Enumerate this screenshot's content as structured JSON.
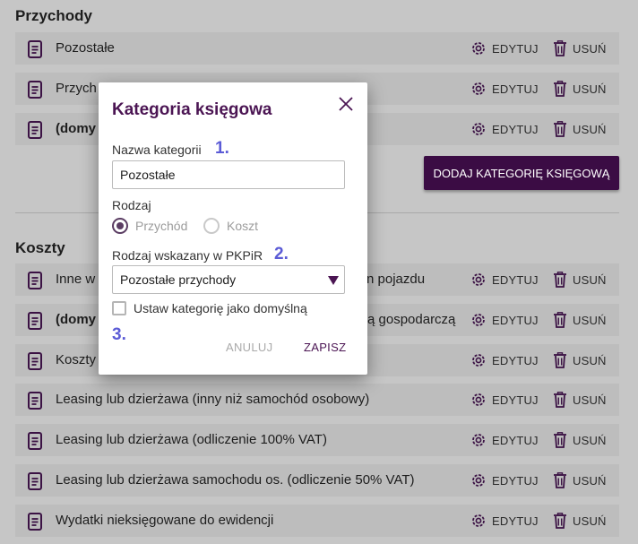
{
  "income": {
    "title": "Przychody",
    "rows": [
      {
        "label": "Pozostałe",
        "bold": false
      },
      {
        "label": "Przych",
        "bold": false
      },
      {
        "label": "(domy",
        "bold": true
      }
    ],
    "add_button_label": "DODAJ KATEGORIĘ KSIĘGOWĄ"
  },
  "costs": {
    "title": "Koszty",
    "rows": [
      {
        "label": "Inne w",
        "tail": "n pojazdu",
        "bold": false
      },
      {
        "label": "(domy",
        "tail": "ą gospodarczą",
        "bold": true
      },
      {
        "label": "Koszty",
        "tail": "",
        "bold": false
      },
      {
        "label": "Leasing lub dzierżawa (inny niż samochód osobowy)",
        "tail": "",
        "bold": false
      },
      {
        "label": "Leasing lub dzierżawa (odliczenie 100% VAT)",
        "tail": "",
        "bold": false
      },
      {
        "label": "Leasing lub dzierżawa samochodu os. (odliczenie 50% VAT)",
        "tail": "",
        "bold": false
      },
      {
        "label": "Wydatki nieksięgowane do ewidencji",
        "tail": "",
        "bold": false
      }
    ]
  },
  "actions": {
    "edit_label": "EDYTUJ",
    "delete_label": "USUŃ"
  },
  "modal": {
    "title": "Kategoria księgowa",
    "name_label": "Nazwa kategorii",
    "name_value": "Pozostałe",
    "type_label": "Rodzaj",
    "type_options": [
      "Przychód",
      "Koszt"
    ],
    "type_selected": "Przychód",
    "pkpir_label": "Rodzaj wskazany w PKPiR",
    "pkpir_value": "Pozostałe przychody",
    "default_checkbox_label": "Ustaw kategorię jako domyślną",
    "default_checked": false,
    "cancel_label": "ANULUJ",
    "save_label": "ZAPISZ",
    "step_markers": [
      "1.",
      "2.",
      "3."
    ]
  },
  "colors": {
    "brand": "#3b0c44",
    "title_purple": "#4b1553",
    "step_blue": "#5b5bd6",
    "overlay_bg": "#c6c6c6",
    "row_bg": "#bdbdbd"
  },
  "icons": {
    "row": "document-icon",
    "edit": "gear-icon",
    "delete": "trash-icon",
    "close": "close-icon",
    "select": "caret-down-icon"
  }
}
